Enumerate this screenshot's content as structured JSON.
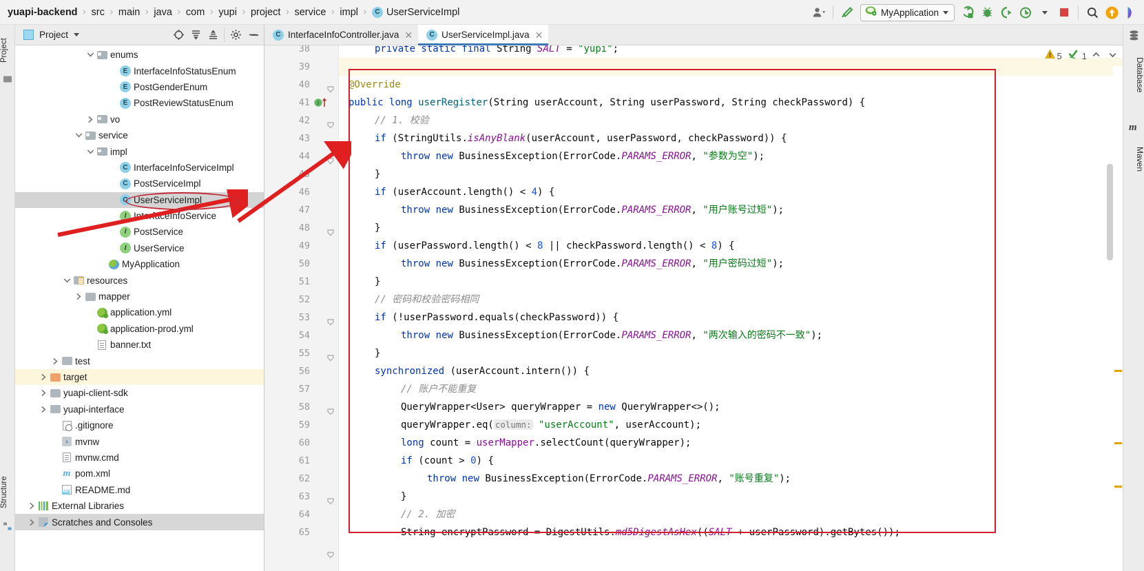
{
  "window": {
    "breadcrumb": [
      {
        "label": "yuapi-backend",
        "root": true
      },
      {
        "label": "src"
      },
      {
        "label": "main"
      },
      {
        "label": "java"
      },
      {
        "label": "com"
      },
      {
        "label": "yupi"
      },
      {
        "label": "project"
      },
      {
        "label": "service"
      },
      {
        "label": "impl"
      },
      {
        "label": "UserServiceImpl",
        "icon": "class-icon",
        "badge": "C"
      }
    ]
  },
  "toolbar": {
    "run_config_label": "MyApplication",
    "icons": [
      "user-avatar-icon",
      "hammer-build-icon",
      "run-icon",
      "debug-icon",
      "run-with-coverage-icon",
      "profiler-icon",
      "stop-icon",
      "search-everywhere-icon",
      "update-project-icon",
      "ide-assistant-icon"
    ]
  },
  "left_strip": {
    "project_label": "Project",
    "structure_label": "Structure"
  },
  "project_panel": {
    "title": "Project",
    "header_icons": [
      "locate-icon",
      "expand-all-icon",
      "collapse-all-icon",
      "gear-icon",
      "hide-icon"
    ],
    "tree": [
      {
        "label": "enums",
        "indent": 6,
        "twist": "down",
        "icon": "package-folder-icon"
      },
      {
        "label": "InterfaceInfoStatusEnum",
        "indent": 8,
        "twist": "none",
        "icon": "enum-icon",
        "badge": "E"
      },
      {
        "label": "PostGenderEnum",
        "indent": 8,
        "twist": "none",
        "icon": "enum-icon",
        "badge": "E"
      },
      {
        "label": "PostReviewStatusEnum",
        "indent": 8,
        "twist": "none",
        "icon": "enum-icon",
        "badge": "E"
      },
      {
        "label": "vo",
        "indent": 6,
        "twist": "right",
        "icon": "package-folder-icon"
      },
      {
        "label": "service",
        "indent": 5,
        "twist": "down",
        "icon": "package-folder-icon"
      },
      {
        "label": "impl",
        "indent": 6,
        "twist": "down",
        "icon": "package-folder-icon"
      },
      {
        "label": "InterfaceInfoServiceImpl",
        "indent": 8,
        "twist": "none",
        "icon": "class-icon",
        "badge": "C"
      },
      {
        "label": "PostServiceImpl",
        "indent": 8,
        "twist": "none",
        "icon": "class-icon",
        "badge": "C"
      },
      {
        "label": "UserServiceImpl",
        "indent": 8,
        "twist": "none",
        "icon": "class-icon",
        "badge": "C",
        "selected": true
      },
      {
        "label": "InterfaceInfoService",
        "indent": 8,
        "twist": "none",
        "icon": "interface-icon",
        "badge": "I"
      },
      {
        "label": "PostService",
        "indent": 8,
        "twist": "none",
        "icon": "interface-icon",
        "badge": "I"
      },
      {
        "label": "UserService",
        "indent": 8,
        "twist": "none",
        "icon": "interface-icon",
        "badge": "I"
      },
      {
        "label": "MyApplication",
        "indent": 7,
        "twist": "none",
        "icon": "spring-boot-class-icon"
      },
      {
        "label": "resources",
        "indent": 4,
        "twist": "down",
        "icon": "resources-folder-icon"
      },
      {
        "label": "mapper",
        "indent": 5,
        "twist": "right",
        "icon": "folder-icon"
      },
      {
        "label": "application.yml",
        "indent": 6,
        "twist": "none",
        "icon": "spring-yaml-icon"
      },
      {
        "label": "application-prod.yml",
        "indent": 6,
        "twist": "none",
        "icon": "spring-yaml-icon"
      },
      {
        "label": "banner.txt",
        "indent": 6,
        "twist": "none",
        "icon": "text-file-icon"
      },
      {
        "label": "test",
        "indent": 3,
        "twist": "right",
        "icon": "folder-icon"
      },
      {
        "label": "target",
        "indent": 2,
        "twist": "right",
        "icon": "excluded-folder-icon",
        "highlight": true
      },
      {
        "label": "yuapi-client-sdk",
        "indent": 2,
        "twist": "right",
        "icon": "folder-icon"
      },
      {
        "label": "yuapi-interface",
        "indent": 2,
        "twist": "right",
        "icon": "folder-icon"
      },
      {
        "label": ".gitignore",
        "indent": 3,
        "twist": "none",
        "icon": "gitignore-icon"
      },
      {
        "label": "mvnw",
        "indent": 3,
        "twist": "none",
        "icon": "script-file-icon"
      },
      {
        "label": "mvnw.cmd",
        "indent": 3,
        "twist": "none",
        "icon": "text-file-icon"
      },
      {
        "label": "pom.xml",
        "indent": 3,
        "twist": "none",
        "icon": "maven-pom-icon"
      },
      {
        "label": "README.md",
        "indent": 3,
        "twist": "none",
        "icon": "markdown-icon"
      },
      {
        "label": "External Libraries",
        "indent": 1,
        "twist": "right",
        "icon": "external-libraries-icon"
      },
      {
        "label": "Scratches and Consoles",
        "indent": 1,
        "twist": "right",
        "icon": "scratches-icon",
        "selected_gray": true
      }
    ]
  },
  "editor": {
    "tabs": [
      {
        "label": "InterfaceInfoController.java",
        "badge": "C",
        "active": false
      },
      {
        "label": "UserServiceImpl.java",
        "badge": "C",
        "active": true
      }
    ],
    "inspection": {
      "warning_count": "5",
      "ok_count": "1"
    },
    "first_visible_line": 38,
    "lines": [
      {
        "n": 38,
        "partial": true,
        "html": "<span class=\"kw\">private static final</span> <span class=\"plain\">String </span><span class=\"stat\">SALT</span> <span class=\"plain\">= </span><span class=\"str\">\"yupi\"</span><span class=\"plain\">;</span>",
        "indent": 1
      },
      {
        "n": 39,
        "html": ""
      },
      {
        "n": 40,
        "html": "<span class=\"anno\">@Override</span>",
        "indent": 0
      },
      {
        "n": 41,
        "html": "<span class=\"kw\">public</span> <span class=\"kw\">long</span> <span class=\"meth\">userRegister</span><span class=\"plain\">(String userAccount, String userPassword, String checkPassword) {</span>",
        "indent": 0,
        "gutter_mark": "implementing-method-icon"
      },
      {
        "n": 42,
        "html": "<span class=\"cmt\">// 1. 校验</span>",
        "indent": 1
      },
      {
        "n": 43,
        "html": "<span class=\"kw\">if</span> <span class=\"plain\">(StringUtils.</span><span class=\"stat\">isAnyBlank</span><span class=\"plain\">(userAccount, userPassword, checkPassword)) {</span>",
        "indent": 1
      },
      {
        "n": 44,
        "html": "<span class=\"kw\">throw</span> <span class=\"kw\">new</span> <span class=\"plain\">BusinessException(ErrorCode.</span><span class=\"stat\">PARAMS_ERROR</span><span class=\"plain\">, </span><span class=\"str\">\"参数为空\"</span><span class=\"plain\">);</span>",
        "indent": 2
      },
      {
        "n": 45,
        "html": "<span class=\"plain\">}</span>",
        "indent": 1
      },
      {
        "n": 46,
        "html": "<span class=\"kw\">if</span> <span class=\"plain\">(userAccount.length() &lt; </span><span class=\"num\">4</span><span class=\"plain\">) {</span>",
        "indent": 1
      },
      {
        "n": 47,
        "html": "<span class=\"kw\">throw</span> <span class=\"kw\">new</span> <span class=\"plain\">BusinessException(ErrorCode.</span><span class=\"stat\">PARAMS_ERROR</span><span class=\"plain\">, </span><span class=\"str\">\"用户账号过短\"</span><span class=\"plain\">);</span>",
        "indent": 2
      },
      {
        "n": 48,
        "html": "<span class=\"plain\">}</span>",
        "indent": 1
      },
      {
        "n": 49,
        "html": "<span class=\"kw\">if</span> <span class=\"plain\">(userPassword.length() &lt; </span><span class=\"num\">8</span><span class=\"plain\"> || checkPassword.length() &lt; </span><span class=\"num\">8</span><span class=\"plain\">) {</span>",
        "indent": 1
      },
      {
        "n": 50,
        "html": "<span class=\"kw\">throw</span> <span class=\"kw\">new</span> <span class=\"plain\">BusinessException(ErrorCode.</span><span class=\"stat\">PARAMS_ERROR</span><span class=\"plain\">, </span><span class=\"str\">\"用户密码过短\"</span><span class=\"plain\">);</span>",
        "indent": 2
      },
      {
        "n": 51,
        "html": "<span class=\"plain\">}</span>",
        "indent": 1
      },
      {
        "n": 52,
        "html": "<span class=\"cmt\">// 密码和校验密码相同</span>",
        "indent": 1
      },
      {
        "n": 53,
        "html": "<span class=\"kw\">if</span> <span class=\"plain\">(!userPassword.equals(checkPassword)) {</span>",
        "indent": 1
      },
      {
        "n": 54,
        "html": "<span class=\"kw\">throw</span> <span class=\"kw\">new</span> <span class=\"plain\">BusinessException(ErrorCode.</span><span class=\"stat\">PARAMS_ERROR</span><span class=\"plain\">, </span><span class=\"str\">\"两次输入的密码不一致\"</span><span class=\"plain\">);</span>",
        "indent": 2
      },
      {
        "n": 55,
        "html": "<span class=\"plain\">}</span>",
        "indent": 1
      },
      {
        "n": 56,
        "html": "<span class=\"kw\">synchronized</span> <span class=\"plain\">(userAccount.intern()) {</span>",
        "indent": 1
      },
      {
        "n": 57,
        "html": "<span class=\"cmt\">// 账户不能重复</span>",
        "indent": 2
      },
      {
        "n": 58,
        "html": "<span class=\"plain\">QueryWrapper&lt;User&gt; queryWrapper = </span><span class=\"kw\">new</span><span class=\"plain\"> QueryWrapper&lt;&gt;();</span>",
        "indent": 2
      },
      {
        "n": 59,
        "html": "<span class=\"plain\">queryWrapper.eq(</span><span class=\"hint\">column:</span><span class=\"plain\"> </span><span class=\"str\">\"userAccount\"</span><span class=\"plain\">, userAccount);</span>",
        "indent": 2
      },
      {
        "n": 60,
        "html": "<span class=\"kw\">long</span> <span class=\"plain\">count = </span><span class=\"field\">userMapper</span><span class=\"plain\">.selectCount(queryWrapper);</span>",
        "indent": 2
      },
      {
        "n": 61,
        "html": "<span class=\"kw\">if</span> <span class=\"plain\">(count &gt; </span><span class=\"num\">0</span><span class=\"plain\">) {</span>",
        "indent": 2
      },
      {
        "n": 62,
        "html": "<span class=\"kw\">throw</span> <span class=\"kw\">new</span> <span class=\"plain\">BusinessException(ErrorCode.</span><span class=\"stat\">PARAMS_ERROR</span><span class=\"plain\">, </span><span class=\"str\">\"账号重复\"</span><span class=\"plain\">);</span>",
        "indent": 3
      },
      {
        "n": 63,
        "html": "<span class=\"plain\">}</span>",
        "indent": 2
      },
      {
        "n": 64,
        "html": "<span class=\"cmt\">// 2. 加密</span>",
        "indent": 2
      },
      {
        "n": 65,
        "html": "<span class=\"plain\">String encryptPassword = DigestUtils.</span><span class=\"stat\">md5DigestAsHex</span><span class=\"plain\">((</span><span class=\"stat\">SALT</span><span class=\"plain\"> + userPassword).getBytes());</span>",
        "indent": 2
      }
    ]
  },
  "right_strip": {
    "database_label": "Database",
    "maven_label": "Maven"
  },
  "annotations": {
    "highlight_color": "#d32030",
    "ellipse_target": "UserServiceImpl",
    "rect_target": "userRegister-method-body"
  }
}
